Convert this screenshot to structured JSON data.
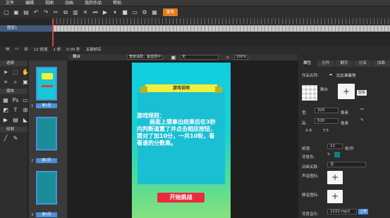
{
  "menu": [
    "文件",
    "编辑",
    "视图",
    "动画",
    "我的作品",
    "帮助"
  ],
  "toolbar": {
    "publish_label": "发布"
  },
  "timeline": {
    "layer_name": "图层1",
    "status_fps": "12 帧速",
    "status_frame": "1 帧",
    "status_time": "0.00 秒",
    "status_keyframe": "关键帧名"
  },
  "left_panel": {
    "sections": [
      "选择",
      "媒体",
      "绘制"
    ],
    "page_labels": [
      "第1页",
      "第2页",
      "第3页"
    ],
    "page_numbers": [
      "1",
      "2",
      "3"
    ]
  },
  "stage_bar": {
    "tab": "舞台",
    "fit_mode": "宽度适配，垂直居中",
    "layer_select": "无",
    "zoom": "100%"
  },
  "phone": {
    "banner": "游戏说明",
    "rules_title": "游戏规则：",
    "rules_text": "画面上猜事出结果后在3秒内判断道置了并点击相应按钮，猜对了加10分，一共10轮，看看谁的分数高。",
    "start_button": "开始挑战"
  },
  "right_panel": {
    "tabs": [
      "属性",
      "元件",
      "翻页",
      "分享",
      "加载"
    ],
    "work_name_label": "作品名称:",
    "work_name_value": "比比谁最快",
    "stage_label": "舞台",
    "image_button": "图像",
    "width_label": "宽:",
    "width_value": "320",
    "width_unit": "像素",
    "height_label": "高:",
    "height_value": "520",
    "height_unit": "像素",
    "x_label": "X-8",
    "y_label": "Y:5",
    "fps_label": "帧速:",
    "fps_value": "12",
    "fps_unit": "帧/秒",
    "bgcolor_label": "背景色:",
    "anim_label": "动画关联:",
    "anim_value": "无",
    "sound_on_label": "声音图标:",
    "sound_off_label": "静音图标:",
    "bgm_label": "背景音乐:",
    "bgm_value": "1222.mp3",
    "upload_label": "上传"
  },
  "colors": {
    "publish": "#e27a1a",
    "timeline_layer": "#3f5c7d",
    "selection": "#4a90d9",
    "start_button": "#ec2a3e",
    "banner": "#f2ef3a",
    "bgcolor_swatch": "#0e7f86"
  }
}
